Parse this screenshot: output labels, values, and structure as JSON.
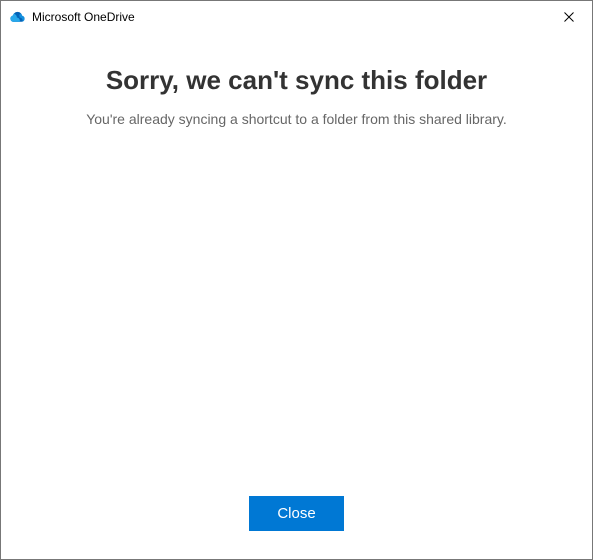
{
  "titlebar": {
    "title": "Microsoft OneDrive",
    "icon": "onedrive-cloud-icon"
  },
  "content": {
    "heading": "Sorry, we can't sync this folder",
    "message": "You're already syncing a shortcut to a folder from this shared library."
  },
  "footer": {
    "close_label": "Close"
  },
  "colors": {
    "primary": "#0078d4"
  }
}
